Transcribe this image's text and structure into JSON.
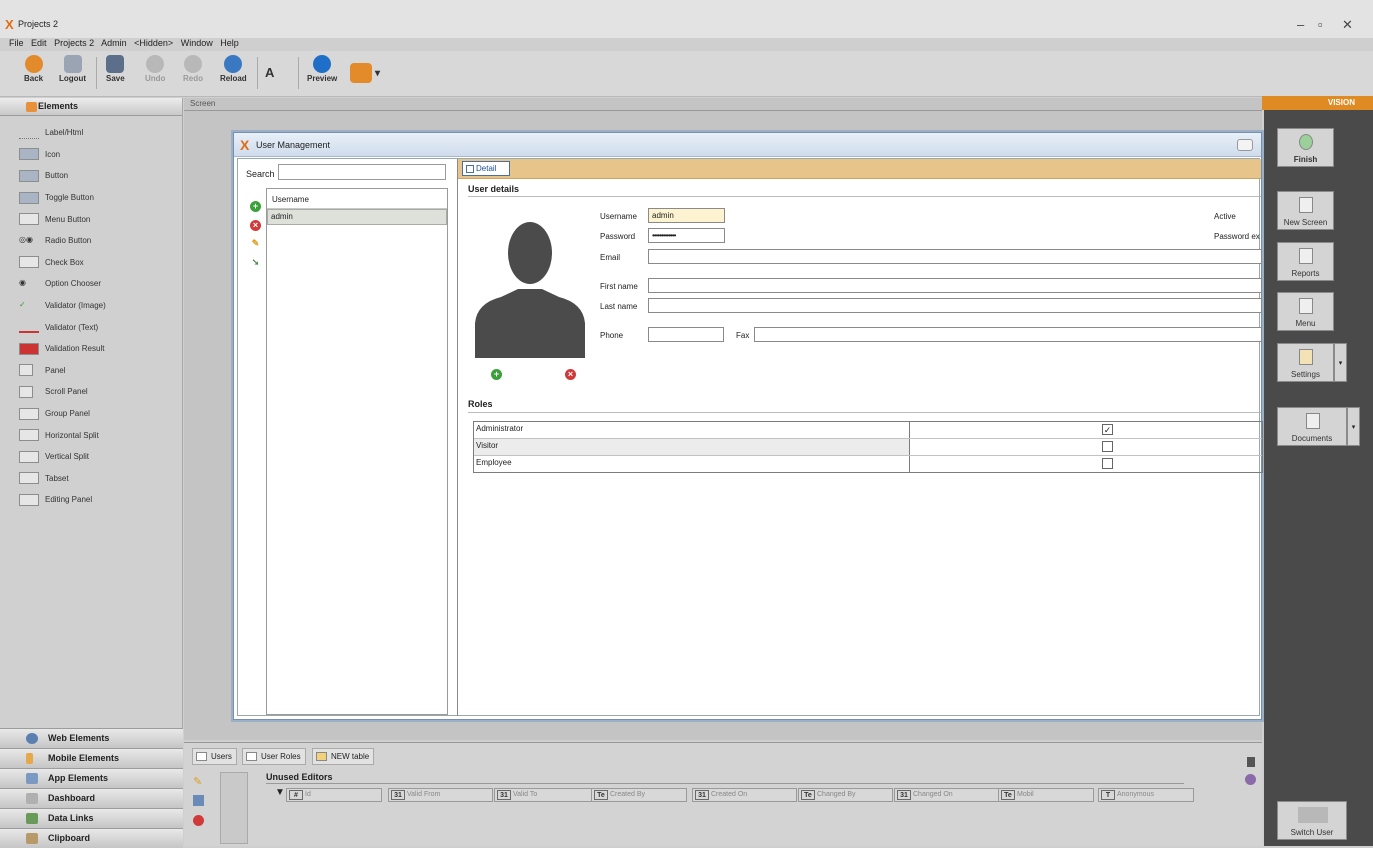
{
  "app": {
    "title": "Projects 2",
    "logo": "X"
  },
  "menu": [
    "File",
    "Edit",
    "Projects 2",
    "Admin",
    "<Hidden>",
    "Window",
    "Help"
  ],
  "window_controls": {
    "minimize": "–",
    "restore": "▫",
    "close": "✕"
  },
  "toolbar": {
    "back": "Back",
    "logout": "Logout",
    "save": "Save",
    "undo": "Undo",
    "redo": "Redo",
    "reload": "Reload",
    "preview": "Preview"
  },
  "left_panel": {
    "header": "Elements",
    "items": [
      "Label/Html",
      "Icon",
      "Button",
      "Toggle Button",
      "Menu Button",
      "Radio Button",
      "Check Box",
      "Option Chooser",
      "Validator (Image)",
      "Validator (Text)",
      "Validation Result",
      "Panel",
      "Scroll Panel",
      "Group Panel",
      "Horizontal Split",
      "Vertical Split",
      "Tabset",
      "Editing Panel"
    ],
    "accordion": [
      "Web Elements",
      "Mobile Elements",
      "App Elements",
      "Dashboard",
      "Data Links",
      "Clipboard"
    ]
  },
  "screen_tab": "Screen",
  "dialog": {
    "title": "User Management",
    "search_label": "Search",
    "search_value": "",
    "list_header": "Username",
    "list_rows": [
      "admin"
    ],
    "detail_tab": "Detail",
    "user_details_title": "User details",
    "fields": {
      "username_label": "Username",
      "username_value": "admin",
      "password_label": "Password",
      "password_value": "•••••••••••••",
      "email_label": "Email",
      "email_value": "",
      "firstname_label": "First name",
      "firstname_value": "",
      "lastname_label": "Last name",
      "lastname_value": "",
      "phone_label": "Phone",
      "phone_value": "",
      "fax_label": "Fax",
      "fax_value": "",
      "active_label": "Active",
      "password_expiry_label": "Password ex"
    },
    "roles_title": "Roles",
    "roles": [
      {
        "name": "Administrator",
        "checked": true,
        "check": "✓"
      },
      {
        "name": "Visitor",
        "checked": false,
        "check": ""
      },
      {
        "name": "Employee",
        "checked": false,
        "check": ""
      }
    ]
  },
  "right_panel": {
    "vision_label": "VISION",
    "buttons": [
      "Finish",
      "New Screen",
      "Reports",
      "Menu",
      "Settings",
      "Documents",
      "Switch User"
    ]
  },
  "bottom_panel": {
    "tabs": [
      "Users",
      "User Roles",
      "NEW table"
    ],
    "unused_editors_title": "Unused Editors",
    "fields": [
      {
        "type": "#",
        "label": "Id"
      },
      {
        "type": "31",
        "label": "Valid From"
      },
      {
        "type": "31",
        "label": "Valid To"
      },
      {
        "type": "Te",
        "label": "Created By"
      },
      {
        "type": "31",
        "label": "Created On"
      },
      {
        "type": "Te",
        "label": "Changed By"
      },
      {
        "type": "31",
        "label": "Changed On"
      },
      {
        "type": "Te",
        "label": "Mobil"
      },
      {
        "type": "T",
        "label": "Anonymous"
      }
    ]
  },
  "colors": {
    "accent": "#e08a24",
    "detail_bar": "#e6c48a",
    "right_panel": "#4a4a4a"
  }
}
